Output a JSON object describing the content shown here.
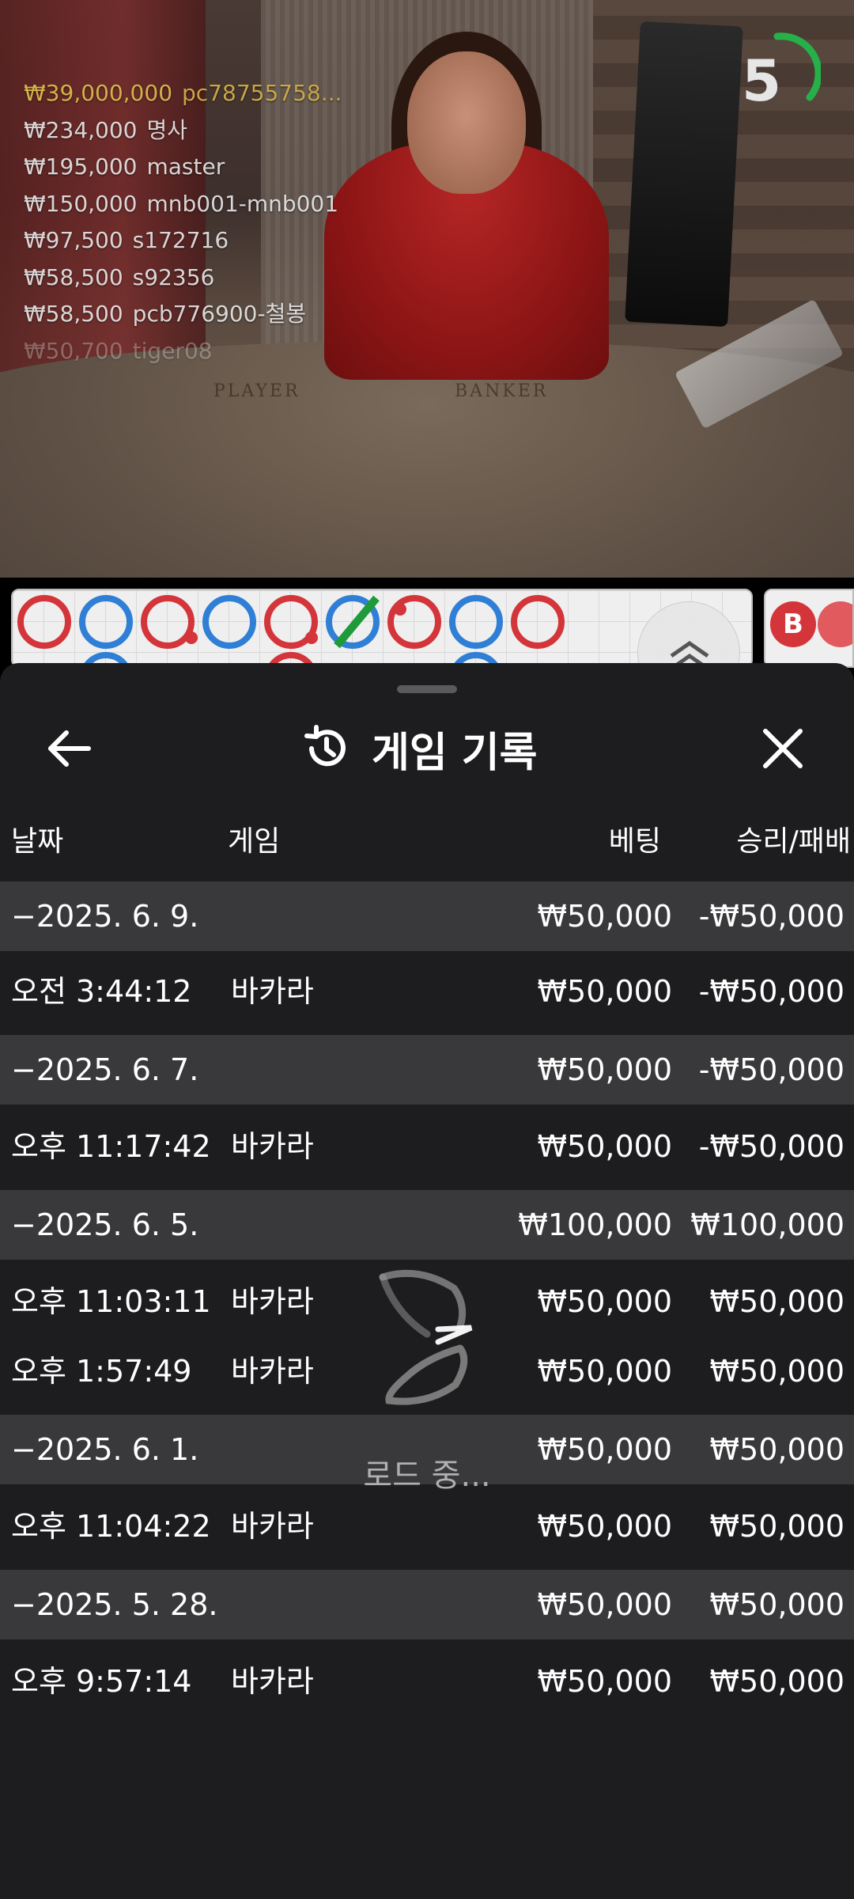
{
  "live": {
    "timer": "5",
    "felt_labels": [
      "PLAYER",
      "BANKER"
    ],
    "bets": [
      {
        "amount": "₩39,000,000",
        "user": "pc78755758..."
      },
      {
        "amount": "₩234,000",
        "user": "명사"
      },
      {
        "amount": "₩195,000",
        "user": "master"
      },
      {
        "amount": "₩150,000",
        "user": "mnb001-mnb001"
      },
      {
        "amount": "₩97,500",
        "user": "s172716"
      },
      {
        "amount": "₩58,500",
        "user": "s92356"
      },
      {
        "amount": "₩58,500",
        "user": "pcb776900-철봉"
      },
      {
        "amount": "₩50,700",
        "user": "tiger08"
      }
    ]
  },
  "road": {
    "second_bead": "B"
  },
  "history": {
    "title": "게임 기록",
    "columns": {
      "date": "날짜",
      "game": "게임",
      "bet": "베팅",
      "result": "승리/패배"
    },
    "groups": [
      {
        "date": "−2025. 6. 9.",
        "bet": "₩50,000",
        "result": "-₩50,000",
        "items": [
          {
            "time": "오전 3:44:12",
            "game": "바카라",
            "bet": "₩50,000",
            "result": "-₩50,000"
          }
        ]
      },
      {
        "date": "−2025. 6. 7.",
        "bet": "₩50,000",
        "result": "-₩50,000",
        "items": [
          {
            "time": "오후 11:17:42",
            "game": "바카라",
            "bet": "₩50,000",
            "result": "-₩50,000"
          }
        ]
      },
      {
        "date": "−2025. 6. 5.",
        "bet": "₩100,000",
        "result": "₩100,000",
        "items": [
          {
            "time": "오후 11:03:11",
            "game": "바카라",
            "bet": "₩50,000",
            "result": "₩50,000"
          },
          {
            "time": "오후 1:57:49",
            "game": "바카라",
            "bet": "₩50,000",
            "result": "₩50,000"
          }
        ]
      },
      {
        "date": "−2025. 6. 1.",
        "bet": "₩50,000",
        "result": "₩50,000",
        "items": [
          {
            "time": "오후 11:04:22",
            "game": "바카라",
            "bet": "₩50,000",
            "result": "₩50,000"
          }
        ]
      },
      {
        "date": "−2025. 5. 28.",
        "bet": "₩50,000",
        "result": "₩50,000",
        "items": [
          {
            "time": "오후 9:57:14",
            "game": "바카라",
            "bet": "₩50,000",
            "result": "₩50,000"
          }
        ]
      }
    ],
    "loading_text": "로드 중..."
  },
  "colors": {
    "sheet_bg": "#1d1d1f",
    "date_row_bg": "#39393b",
    "player_blue": "#2f7fd6",
    "banker_red": "#d3353a",
    "tie_green": "#1f9a3a",
    "top_bet_gold": "#d4b24a"
  }
}
